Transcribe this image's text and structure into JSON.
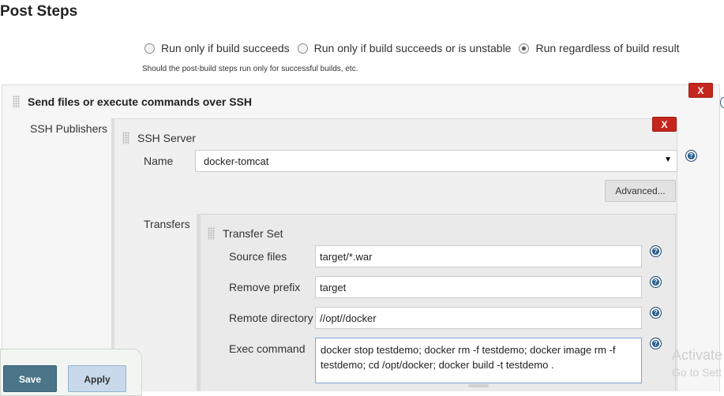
{
  "page": {
    "title": "Post Steps"
  },
  "run_conditions": {
    "options": [
      {
        "label": "Run only if build succeeds",
        "checked": false
      },
      {
        "label": "Run only if build succeeds or is unstable",
        "checked": false
      },
      {
        "label": "Run regardless of build result",
        "checked": true
      }
    ],
    "hint": "Should the post-build steps run only for successful builds, etc."
  },
  "ssh_step": {
    "title": "Send files or execute commands over SSH",
    "delete_label": "X",
    "publishers_label": "SSH Publishers",
    "server": {
      "title": "SSH Server",
      "delete_label": "X",
      "name_label": "Name",
      "name_value": "docker-tomcat",
      "advanced_label": "Advanced...",
      "transfers_label": "Transfers",
      "transfer_set": {
        "title": "Transfer Set",
        "source_files_label": "Source files",
        "source_files_value": "target/*.war",
        "remove_prefix_label": "Remove prefix",
        "remove_prefix_value": "target",
        "remote_directory_label": "Remote directory",
        "remote_directory_value": "//opt//docker",
        "exec_command_label": "Exec command",
        "exec_command_value": "docker stop testdemo; docker rm -f testdemo; docker image rm -f testdemo; cd /opt/docker; docker build -t testdemo ."
      }
    }
  },
  "footer": {
    "save_label": "Save",
    "apply_label": "Apply"
  },
  "watermark": {
    "line1": "Activate",
    "line2": "Go to Sett"
  },
  "colors": {
    "delete_button": "#c4261d",
    "save_button": "#4b7589",
    "apply_button": "#c8d9eb",
    "help_icon": "#2a5d8c"
  }
}
